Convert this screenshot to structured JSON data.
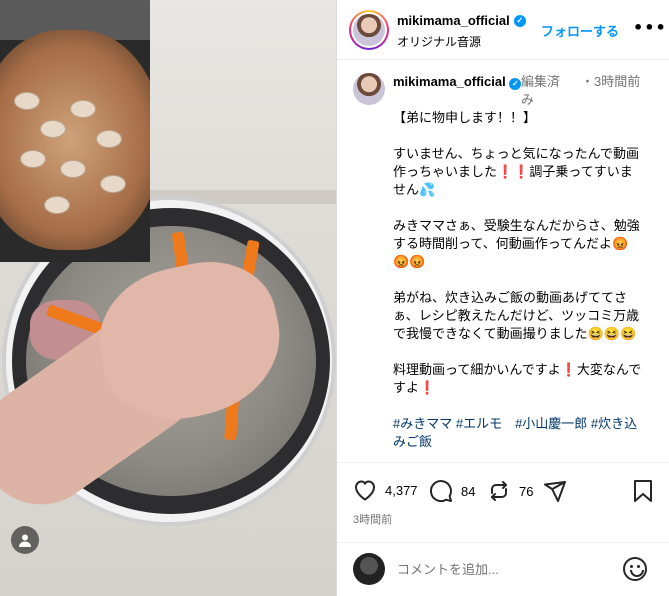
{
  "header": {
    "username": "mikimama_official",
    "subtitle": "オリジナル音源",
    "follow_label": "フォローする",
    "more_label": "•••"
  },
  "caption": {
    "username": "mikimama_official",
    "edited": "編集済み",
    "time": "・3時間前",
    "paragraphs": [
      "【弟に物申します！！】",
      "すいません、ちょっと気になったんで動画作っちゃいました❗❗調子乗ってすいません💦",
      "みきママさぁ、受験生なんだからさ、勉強する時間削って、何動画作ってんだよ😡😡😡",
      "弟がね、炊き込みご飯の動画あげててさぁ、レシピ教えたんだけど、ツッコミ万歳で我慢できなくて動画撮りました😆😆😆",
      "料理動画って細かいんですよ❗大変なんですよ❗"
    ],
    "hashtags": "#みきママ #エルモ　#小山慶一郎 #炊き込みご飯"
  },
  "actions": {
    "likes": "4,377",
    "comments": "84",
    "reposts": "76",
    "posted": "3時間前"
  },
  "comment_box": {
    "placeholder": "コメントを追加..."
  },
  "colors": {
    "accent": "#0095f6",
    "hashtag": "#00376b",
    "muted": "#737373"
  }
}
